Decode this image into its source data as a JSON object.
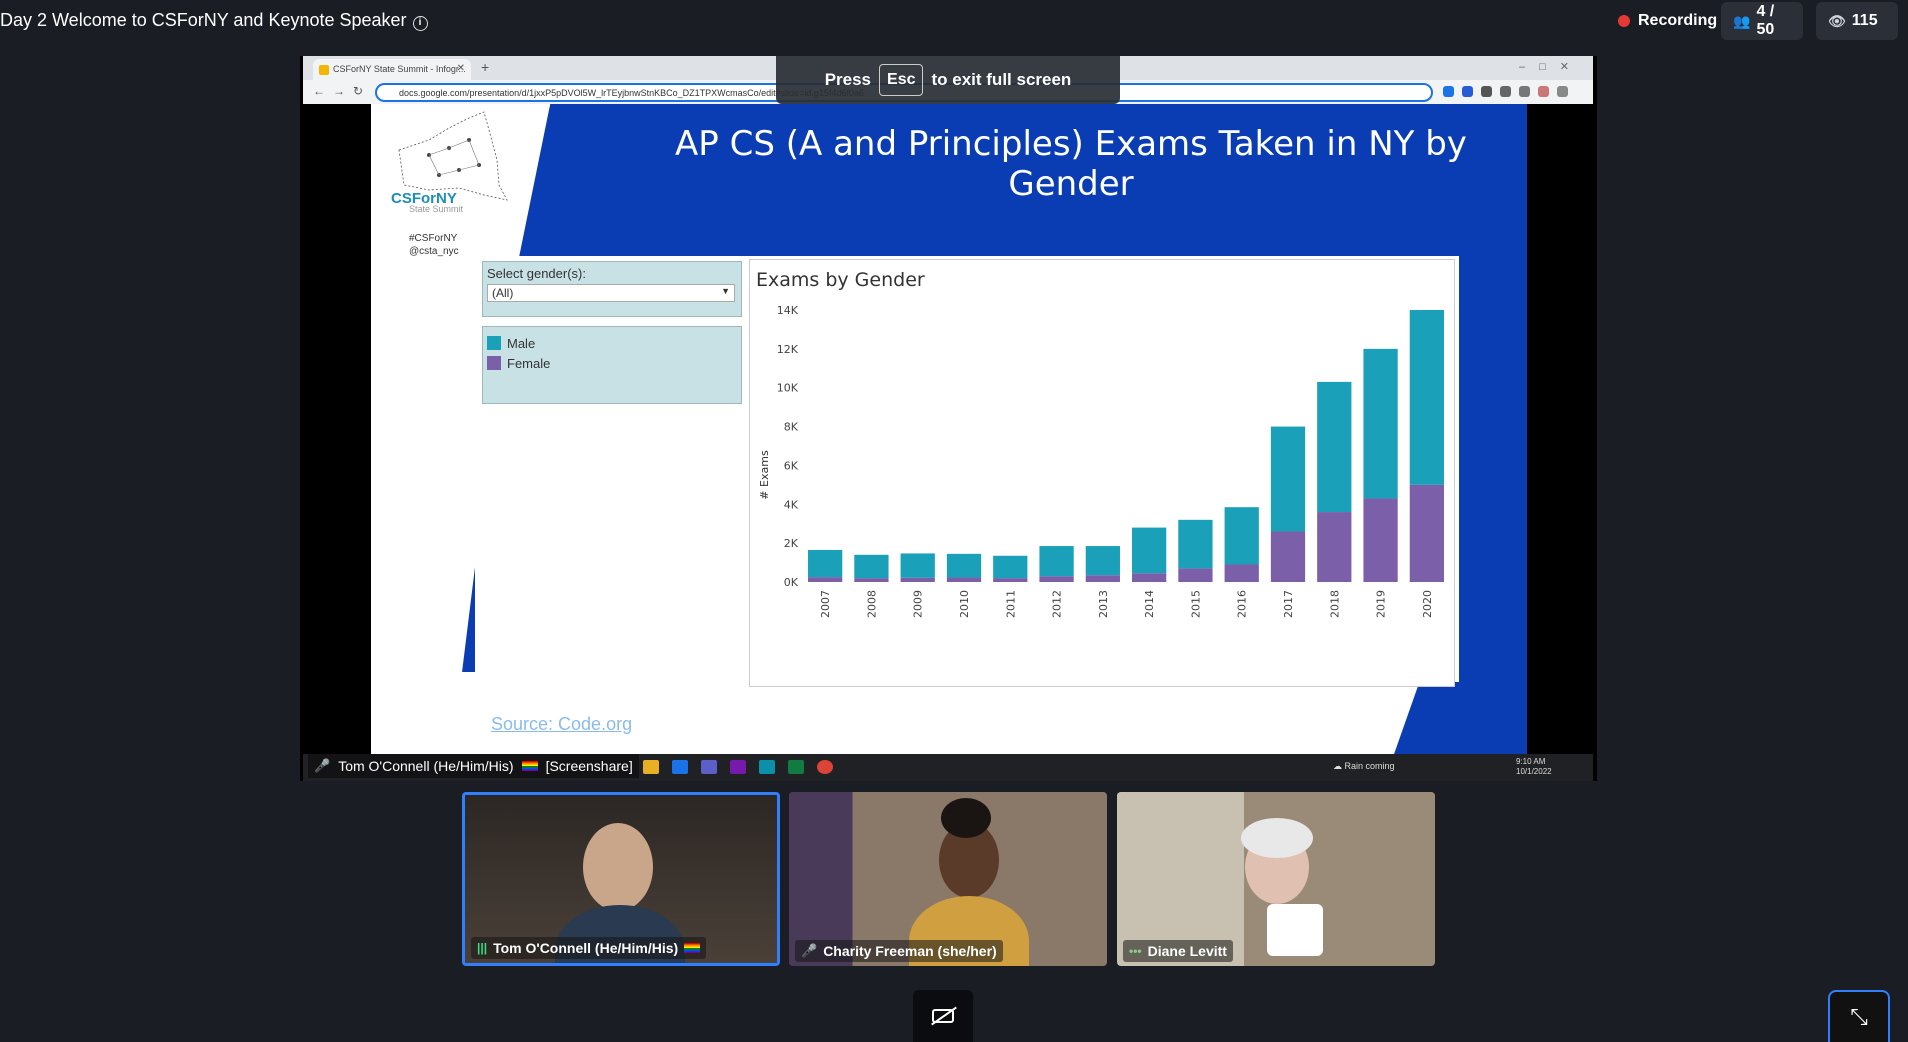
{
  "header": {
    "meeting_title": "Day 2 Welcome to CSForNY and Keynote Speaker",
    "recording_label": "Recording",
    "participants_count": "4 / 50",
    "viewers_count": "115"
  },
  "browser": {
    "tab_title": "CSForNY State Summit - Infogr...",
    "url": "docs.google.com/presentation/d/1jxxP5pDVOl5W_lrTEyjbnwStnKBCo_DZ1TPXWcmasCo/edit#slide=id.g15f4d6f0a6"
  },
  "fullscreen_banner": {
    "press": "Press",
    "key": "Esc",
    "suffix": "to exit full screen"
  },
  "slide": {
    "title": "AP CS (A and Principles) Exams Taken in NY by Gender",
    "logo_text": "CSForNY",
    "logo_sub": "State Summit",
    "hashtag": "#CSForNY",
    "handle": "@csta_nyc",
    "filter_label": "Select gender(s):",
    "filter_value": "(All)",
    "source": "Source: Code.org"
  },
  "chart_data": {
    "type": "bar",
    "title": "Exams by Gender",
    "ylabel": "# Exams",
    "categories": [
      "2007",
      "2008",
      "2009",
      "2010",
      "2011",
      "2012",
      "2013",
      "2014",
      "2015",
      "2016",
      "2017",
      "2018",
      "2019",
      "2020"
    ],
    "series": [
      {
        "name": "Female",
        "color": "#7b5fa8",
        "values": [
          250,
          200,
          220,
          230,
          200,
          300,
          350,
          450,
          700,
          900,
          2600,
          3600,
          4300,
          5000
        ]
      },
      {
        "name": "Male",
        "color": "#1aa0b8",
        "values": [
          1400,
          1200,
          1250,
          1220,
          1150,
          1550,
          1500,
          2350,
          2500,
          2950,
          5400,
          6700,
          7700,
          9000
        ]
      }
    ],
    "ylim": [
      0,
      14000
    ],
    "yticks": [
      "0K",
      "2K",
      "4K",
      "6K",
      "8K",
      "10K",
      "12K",
      "14K"
    ],
    "stacked": true
  },
  "taskbar": {
    "weather": "Rain coming",
    "time": "9:10 AM",
    "date": "10/1/2022"
  },
  "screenshare_label": {
    "name": "Tom O'Connell (He/Him/His)",
    "suffix": "[Screenshare]"
  },
  "participants": [
    {
      "name": "Tom O'Connell (He/Him/His)",
      "status": "speaking"
    },
    {
      "name": "Charity Freeman (she/her)",
      "status": "muted"
    },
    {
      "name": "Diane Levitt",
      "status": "idle"
    }
  ],
  "colors": {
    "background": "#1a1d24",
    "active_speaker_border": "#2f7fff",
    "slide_blue": "#0a3db3",
    "male": "#1aa0b8",
    "female": "#7b5fa8"
  }
}
